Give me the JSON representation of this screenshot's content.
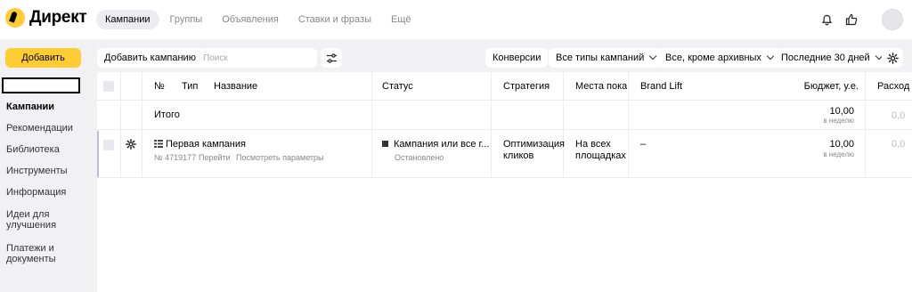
{
  "header": {
    "logo": "Директ",
    "tabs": [
      {
        "label": "Кампании",
        "active": true
      },
      {
        "label": "Группы",
        "active": false
      },
      {
        "label": "Объявления",
        "active": false
      },
      {
        "label": "Ставки и фразы",
        "active": false
      },
      {
        "label": "Ещё",
        "active": false
      }
    ],
    "icons": [
      "bell-icon",
      "thumbs-up-icon",
      "avatar"
    ]
  },
  "sidebar": {
    "add_label": "Добавить",
    "items": [
      {
        "label": "Кампании",
        "active": true
      },
      {
        "label": "Рекомендации"
      },
      {
        "label": "Библиотека"
      },
      {
        "label": "Инструменты"
      },
      {
        "label": "Информация"
      },
      {
        "label": "Идеи для улучшения"
      },
      {
        "label": "Платежи и документы"
      }
    ]
  },
  "toolbar": {
    "add_campaign": "Добавить кампанию",
    "search_placeholder": "Поиск",
    "conversions": "Конверсии",
    "campaign_types": "Все типы кампаний",
    "archive_filter": "Все, кроме архивных",
    "period": "Последние 30 дней"
  },
  "table": {
    "columns": {
      "number": "№",
      "type": "Тип",
      "name": "Название",
      "status": "Статус",
      "strategy": "Стратегия",
      "placements": "Места показа",
      "brand_lift": "Brand Lift",
      "budget": "Бюджет, у.е.",
      "spend": "Расход"
    },
    "total": {
      "label": "Итого",
      "budget": "10,00",
      "budget_period": "в неделю",
      "spend": "0,0"
    },
    "rows": [
      {
        "name": "Первая кампания",
        "id": "№ 4719177",
        "link_go": "Перейти",
        "link_params": "Посмотреть параметры",
        "status": "Кампания или все г...",
        "status_sub": "Остановлено",
        "strategy": "Оптимизация кликов",
        "placements": "На всех площадках",
        "brand_lift": "–",
        "budget": "10,00",
        "budget_period": "в неделю",
        "spend": "0,0"
      }
    ]
  },
  "colors": {
    "accent": "#ffcc33",
    "background": "#f1f1f4",
    "selected_row_bar": "#b8bfd6"
  }
}
